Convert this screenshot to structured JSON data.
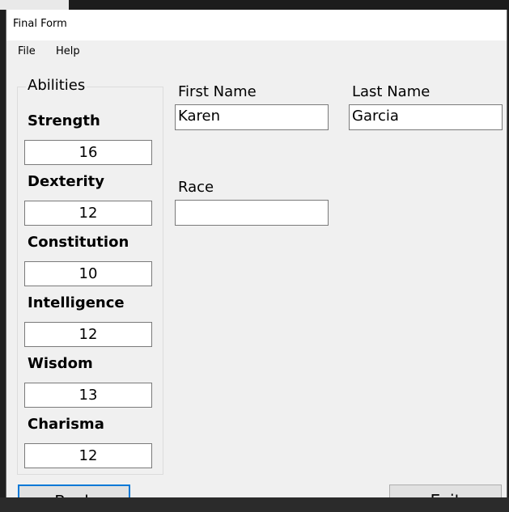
{
  "window": {
    "title": "Final Form"
  },
  "menu": {
    "file_label": "File",
    "help_label": "Help"
  },
  "abilities": {
    "group_title": "Abilities",
    "items": [
      {
        "label": "Strength",
        "value": "16"
      },
      {
        "label": "Dexterity",
        "value": "12"
      },
      {
        "label": "Constitution",
        "value": "10"
      },
      {
        "label": "Intelligence",
        "value": "12"
      },
      {
        "label": "Wisdom",
        "value": "13"
      },
      {
        "label": "Charisma",
        "value": "12"
      }
    ]
  },
  "character": {
    "first_name_label": "First Name",
    "first_name_value": "Karen",
    "last_name_label": "Last Name",
    "last_name_value": "Garcia",
    "race_label": "Race",
    "race_value": ""
  },
  "buttons": {
    "back_label": "Back",
    "exit_label": "Exit"
  }
}
